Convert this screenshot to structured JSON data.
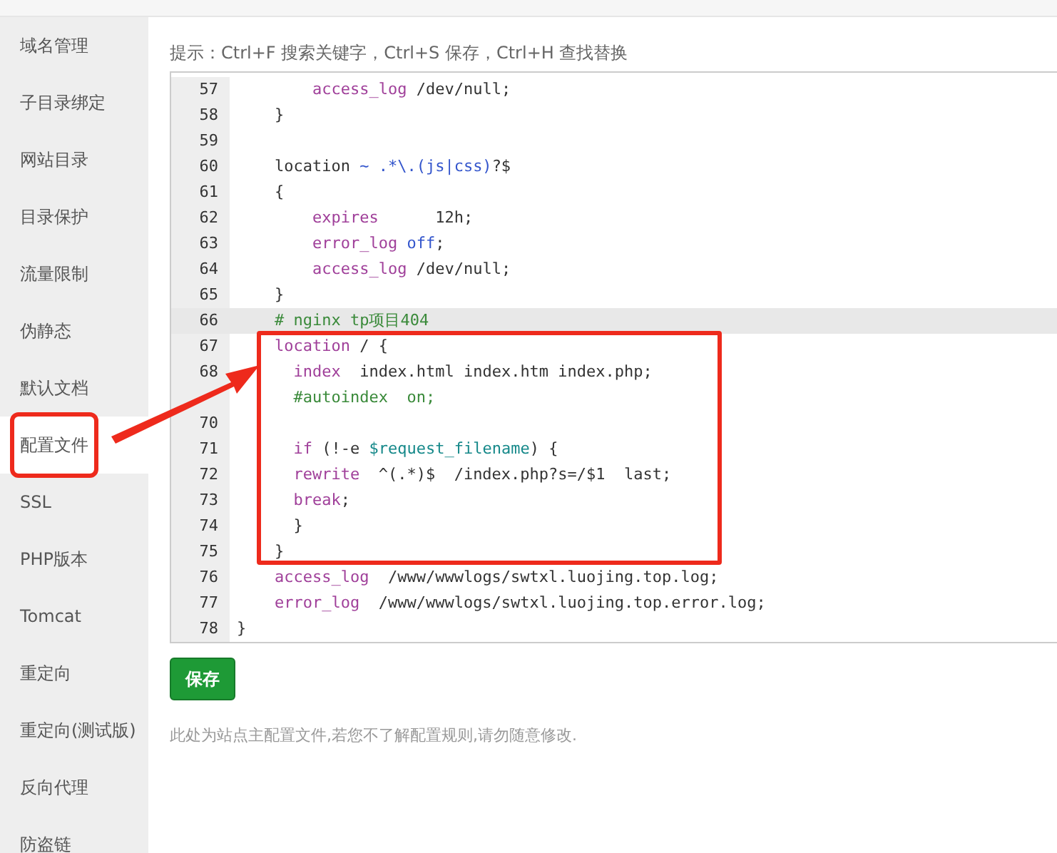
{
  "sidebar": {
    "items": [
      {
        "label": "域名管理",
        "selected": false
      },
      {
        "label": "子目录绑定",
        "selected": false
      },
      {
        "label": "网站目录",
        "selected": false
      },
      {
        "label": "目录保护",
        "selected": false
      },
      {
        "label": "流量限制",
        "selected": false
      },
      {
        "label": "伪静态",
        "selected": false
      },
      {
        "label": "默认文档",
        "selected": false
      },
      {
        "label": "配置文件",
        "selected": true
      },
      {
        "label": "SSL",
        "selected": false
      },
      {
        "label": "PHP版本",
        "selected": false
      },
      {
        "label": "Tomcat",
        "selected": false
      },
      {
        "label": "重定向",
        "selected": false
      },
      {
        "label": "重定向(测试版)",
        "selected": false
      },
      {
        "label": "反向代理",
        "selected": false
      },
      {
        "label": "防盗链",
        "selected": false
      }
    ]
  },
  "hint": "提示：Ctrl+F 搜索关键字，Ctrl+S 保存，Ctrl+H 查找替换",
  "editor": {
    "lines": [
      {
        "number": "57",
        "active": false,
        "tokens": [
          {
            "kind": "keyword",
            "text": "        access_log"
          },
          {
            "kind": "plain",
            "text": " /dev/null;"
          }
        ]
      },
      {
        "number": "58",
        "active": false,
        "tokens": [
          {
            "kind": "plain",
            "text": "    }"
          }
        ]
      },
      {
        "number": "59",
        "active": false
      },
      {
        "number": "60",
        "active": false,
        "tokens": [
          {
            "kind": "plain",
            "text": "    location "
          },
          {
            "kind": "atom",
            "text": "~ .*\\.(js|css)"
          },
          {
            "kind": "plain",
            "text": "?$"
          }
        ]
      },
      {
        "number": "61",
        "active": false,
        "tokens": [
          {
            "kind": "plain",
            "text": "    {"
          }
        ]
      },
      {
        "number": "62",
        "active": false,
        "tokens": [
          {
            "kind": "keyword",
            "text": "        expires"
          },
          {
            "kind": "plain",
            "text": "      12h;"
          }
        ]
      },
      {
        "number": "63",
        "active": false,
        "tokens": [
          {
            "kind": "keyword",
            "text": "        error_log"
          },
          {
            "kind": "atom",
            "text": " off"
          },
          {
            "kind": "plain",
            "text": ";"
          }
        ]
      },
      {
        "number": "64",
        "active": false,
        "tokens": [
          {
            "kind": "keyword",
            "text": "        access_log"
          },
          {
            "kind": "plain",
            "text": " /dev/null;"
          }
        ]
      },
      {
        "number": "65",
        "active": false,
        "tokens": [
          {
            "kind": "plain",
            "text": "    }"
          }
        ]
      },
      {
        "number": "66",
        "active": true,
        "tokens": [
          {
            "kind": "comment",
            "text": "    # nginx tp项目404"
          }
        ]
      },
      {
        "number": "67",
        "active": false,
        "tokens": [
          {
            "kind": "keyword",
            "text": "    location"
          },
          {
            "kind": "plain",
            "text": " / {"
          }
        ]
      },
      {
        "number": "68",
        "active": false,
        "tokens": [
          {
            "kind": "keyword",
            "text": "      index"
          },
          {
            "kind": "plain",
            "text": "  index.html index.htm index.php;"
          }
        ]
      },
      {
        "active": false,
        "tokens": [
          {
            "kind": "comment",
            "text": "      #autoindex  on;"
          }
        ]
      },
      {
        "number": "70",
        "active": false
      },
      {
        "number": "71",
        "active": false,
        "tokens": [
          {
            "kind": "keyword",
            "text": "      if"
          },
          {
            "kind": "plain",
            "text": " (!-e "
          },
          {
            "kind": "variable",
            "text": "$request_filename"
          },
          {
            "kind": "plain",
            "text": ") {"
          }
        ]
      },
      {
        "number": "72",
        "active": false,
        "tokens": [
          {
            "kind": "keyword",
            "text": "      rewrite"
          },
          {
            "kind": "plain",
            "text": "  ^(.*)$  /index.php?s=/$1  last;"
          }
        ]
      },
      {
        "number": "73",
        "active": false,
        "tokens": [
          {
            "kind": "keyword",
            "text": "      break"
          },
          {
            "kind": "plain",
            "text": ";"
          }
        ]
      },
      {
        "number": "74",
        "active": false,
        "tokens": [
          {
            "kind": "plain",
            "text": "      }"
          }
        ]
      },
      {
        "number": "75",
        "active": false,
        "tokens": [
          {
            "kind": "plain",
            "text": "    }"
          }
        ]
      },
      {
        "number": "76",
        "active": false,
        "tokens": [
          {
            "kind": "keyword",
            "text": "    access_log"
          },
          {
            "kind": "plain",
            "text": "  /www/wwwlogs/swtxl.luojing.top.log;"
          }
        ]
      },
      {
        "number": "77",
        "active": false,
        "tokens": [
          {
            "kind": "keyword",
            "text": "    error_log"
          },
          {
            "kind": "plain",
            "text": "  /www/wwwlogs/swtxl.luojing.top.error.log;"
          }
        ]
      },
      {
        "number": "78",
        "active": false,
        "tokens": [
          {
            "kind": "plain",
            "text": "}"
          }
        ]
      }
    ]
  },
  "save_button": "保存",
  "note": "此处为站点主配置文件,若您不了解配置规则,请勿随意修改."
}
